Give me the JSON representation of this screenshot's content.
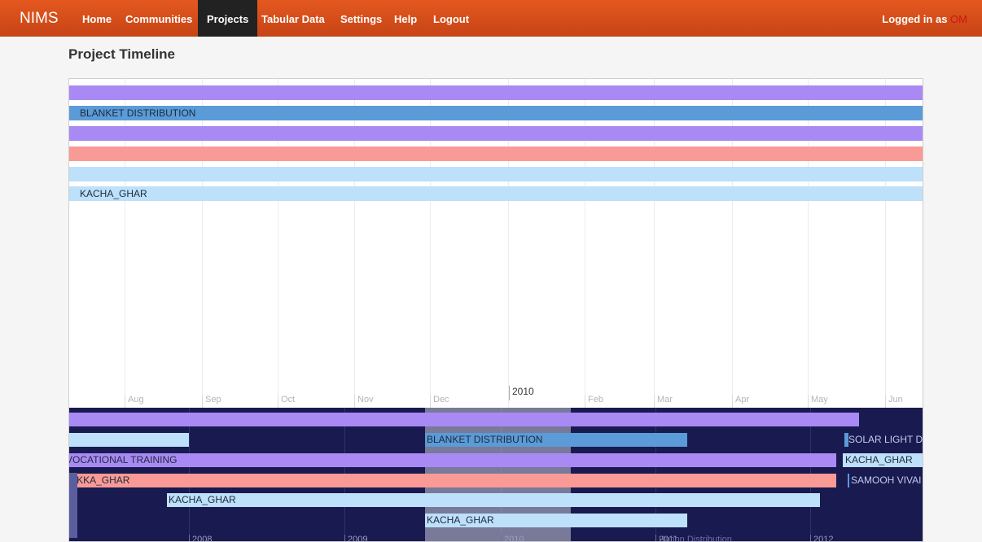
{
  "nav": {
    "brand": "NIMS",
    "items": [
      {
        "label": "Home",
        "active": false
      },
      {
        "label": "Communities",
        "active": false
      },
      {
        "label": "Projects",
        "active": true
      },
      {
        "label": "Tabular Data",
        "active": false
      },
      {
        "label": "Settings",
        "active": false
      },
      {
        "label": "Help",
        "active": false
      },
      {
        "label": "Logout",
        "active": false
      }
    ],
    "login_prefix": "Logged in as",
    "login_user": "OM"
  },
  "page": {
    "title": "Project Timeline"
  },
  "colors": {
    "navbar": "#d9501c",
    "purple": "#a98af5",
    "blue": "#5a9bd8",
    "salmon": "#f99a96",
    "light_blue": "#bde0fb",
    "lower_bg": "#191a4f"
  },
  "timeline": {
    "upper_labels": {
      "blanket": "BLANKET DISTRIBUTION",
      "kacha": "KACHA_GHAR"
    },
    "months": [
      "Aug",
      "Sep",
      "Oct",
      "Nov",
      "Dec",
      "Feb",
      "Mar",
      "Apr",
      "May",
      "Jun"
    ],
    "year": "2010",
    "lower_labels": {
      "blanket": "BLANKET DISTRIBUTION",
      "solar": "SOLAR LIGHT D",
      "vocational": "VOCATIONAL TRAINING",
      "kacha_right": "KACHA_GHAR",
      "pakka": "PAKKA_GHAR",
      "samooh": "SAMOOH VIVAI",
      "kacha_mid": "KACHA_GHAR",
      "kacha_bottom": "KACHA_GHAR"
    },
    "lower_years": [
      "2008",
      "2009",
      "2010",
      "2011",
      "2012"
    ],
    "lower_note": "Ration Distribution"
  }
}
